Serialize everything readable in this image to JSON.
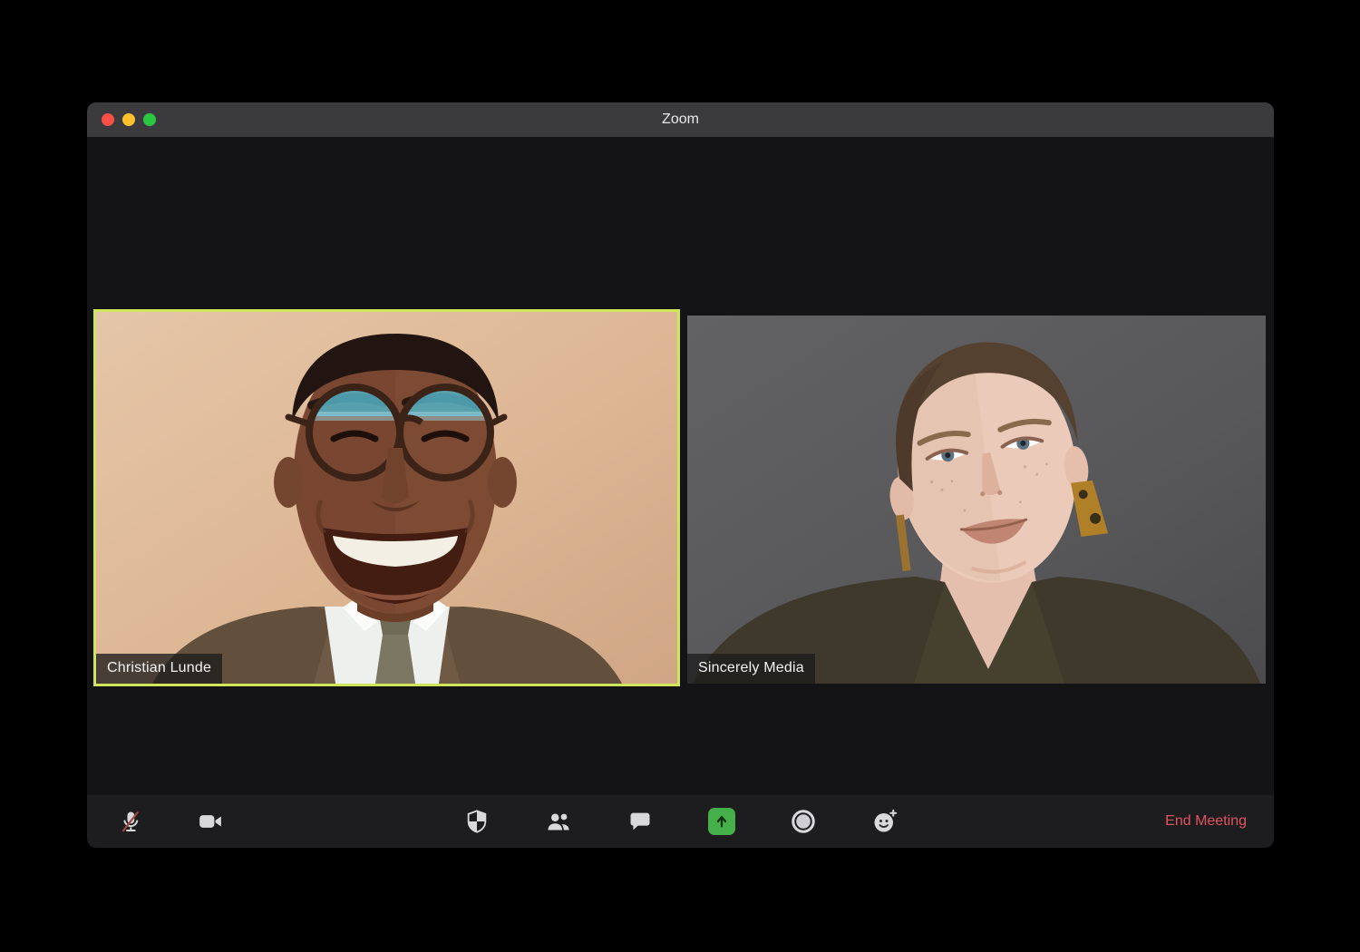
{
  "window": {
    "title": "Zoom",
    "traffic_lights": [
      "close",
      "minimize",
      "zoom"
    ]
  },
  "participants": [
    {
      "name": "Christian Lunde",
      "active_speaker": true
    },
    {
      "name": "Sincerely Media",
      "active_speaker": false
    }
  ],
  "toolbar": {
    "icons": [
      "mic-muted-icon",
      "video-camera-icon",
      "security-shield-icon",
      "participants-icon",
      "chat-bubble-icon",
      "share-screen-icon",
      "record-icon",
      "reactions-icon"
    ],
    "end_meeting_label": "End Meeting"
  },
  "colors": {
    "active_speaker_border": "#cfe55a",
    "end_meeting_text": "#e25463",
    "share_button_green": "#45b049",
    "titlebar_bg": "#3b3b3d",
    "toolbar_bg": "#1d1d1f",
    "content_bg": "#141416",
    "mute_slash_red": "#9e4a44"
  }
}
